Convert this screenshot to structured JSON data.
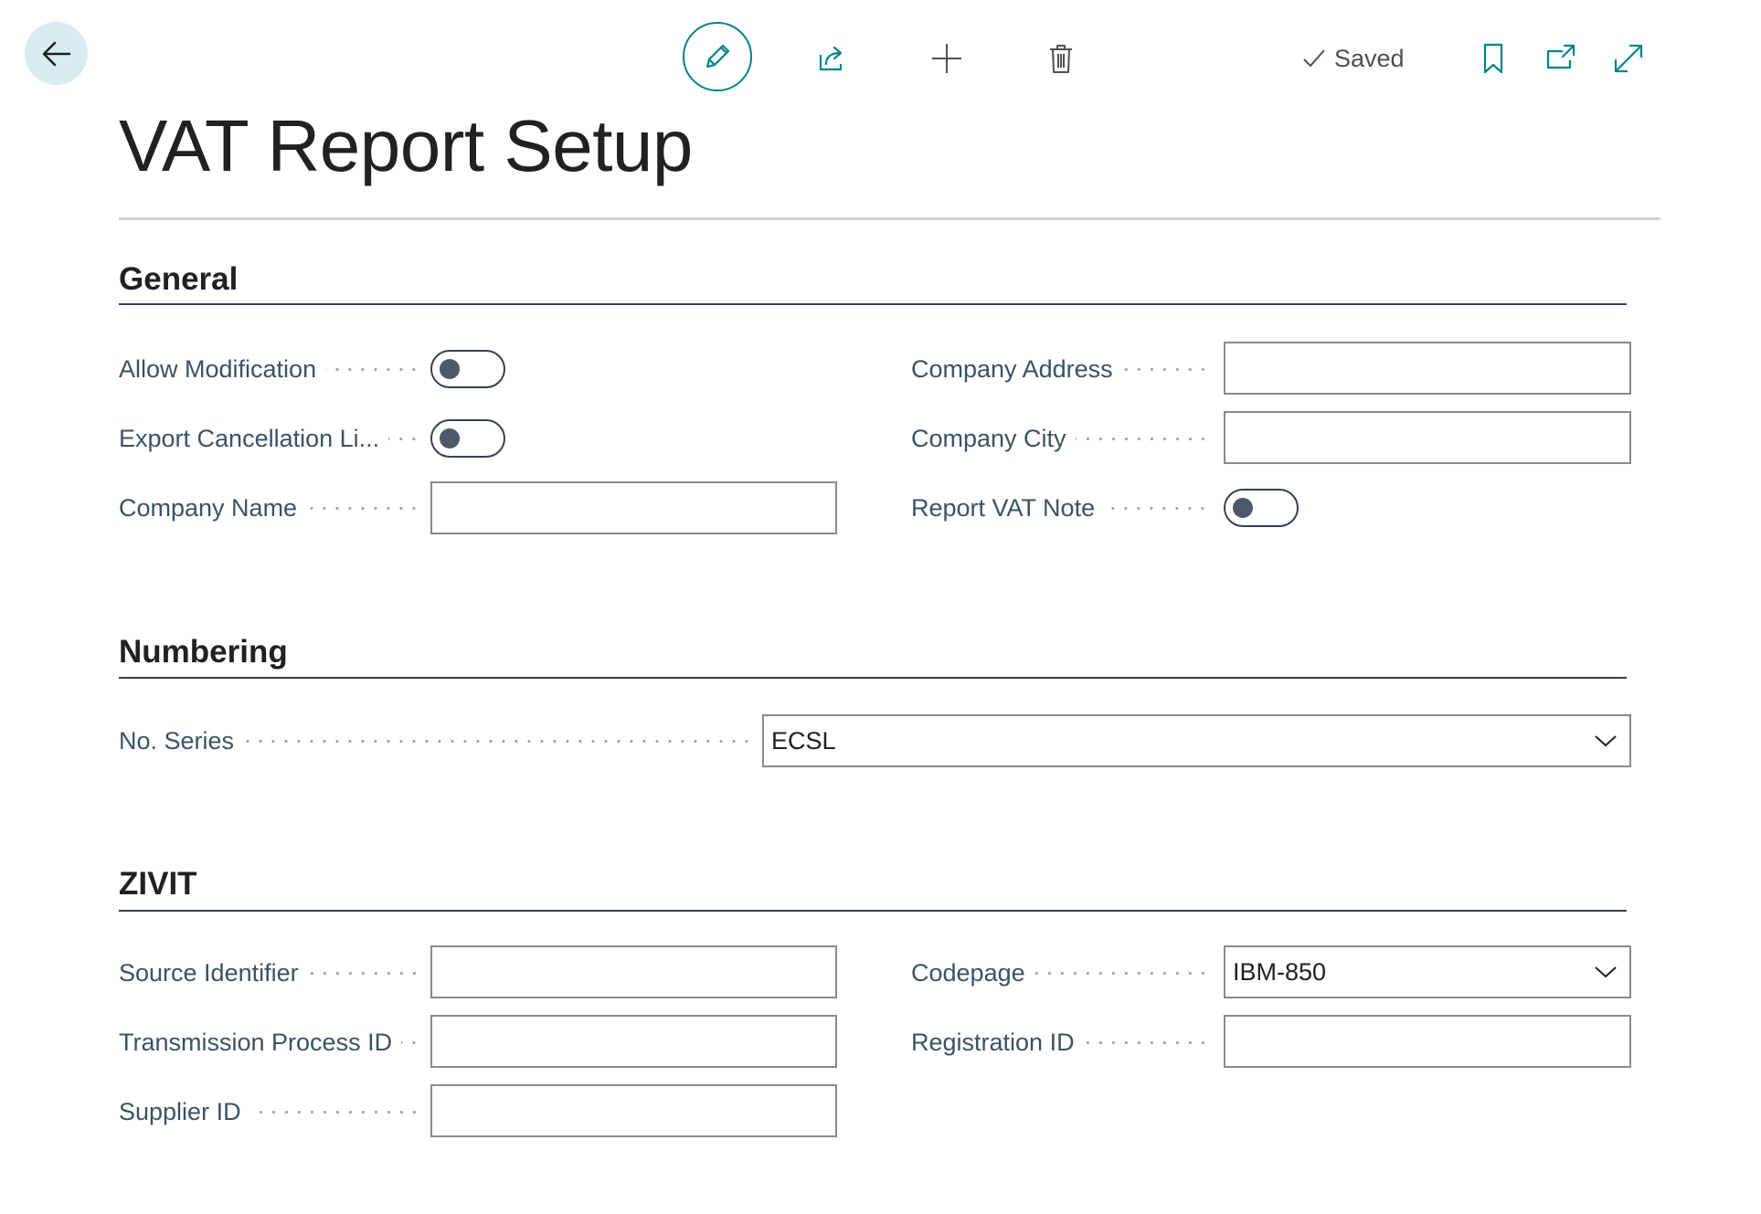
{
  "header": {
    "title": "VAT Report Setup",
    "saved_label": "Saved"
  },
  "sections": {
    "general": {
      "title": "General",
      "allow_modification": {
        "label": "Allow Modification",
        "value": false
      },
      "export_cancellation": {
        "label": "Export Cancellation Li...",
        "value": false
      },
      "company_name": {
        "label": "Company Name",
        "value": ""
      },
      "company_address": {
        "label": "Company Address",
        "value": ""
      },
      "company_city": {
        "label": "Company City",
        "value": ""
      },
      "report_vat_note": {
        "label": "Report VAT Note",
        "value": false
      }
    },
    "numbering": {
      "title": "Numbering",
      "no_series": {
        "label": "No. Series",
        "value": "ECSL"
      }
    },
    "zivit": {
      "title": "ZIVIT",
      "source_identifier": {
        "label": "Source Identifier",
        "value": ""
      },
      "transmission_process_id": {
        "label": "Transmission Process ID",
        "value": ""
      },
      "supplier_id": {
        "label": "Supplier ID",
        "value": ""
      },
      "codepage": {
        "label": "Codepage",
        "value": "IBM-850"
      },
      "registration_id": {
        "label": "Registration ID",
        "value": ""
      }
    }
  },
  "colors": {
    "accent": "#008489",
    "label": "#3c5263",
    "section_rule": "#364052"
  }
}
